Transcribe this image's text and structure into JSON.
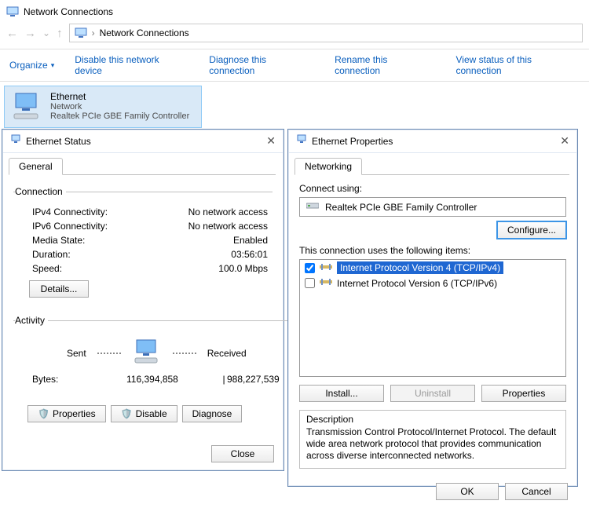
{
  "addressBar": {
    "title": "Network Connections",
    "crumb_sep": "›",
    "crumb": "Network Connections"
  },
  "toolbar": {
    "organize": "Organize",
    "dropdown": "▾",
    "disable": "Disable this network device",
    "diagnose": "Diagnose this connection",
    "rename": "Rename this connection",
    "viewstatus": "View status of this connection"
  },
  "item": {
    "name": "Ethernet",
    "subtype": "Network",
    "adapter": "Realtek PCIe GBE Family Controller"
  },
  "statusDlg": {
    "title": "Ethernet Status",
    "tab": "General",
    "groups": {
      "connection": "Connection",
      "rows": {
        "ipv4_l": "IPv4 Connectivity:",
        "ipv4_v": "No network access",
        "ipv6_l": "IPv6 Connectivity:",
        "ipv6_v": "No network access",
        "media_l": "Media State:",
        "media_v": "Enabled",
        "dur_l": "Duration:",
        "dur_v": "03:56:01",
        "speed_l": "Speed:",
        "speed_v": "100.0 Mbps"
      },
      "details": "Details...",
      "activity": "Activity",
      "sent": "Sent",
      "received": "Received",
      "bytes_l": "Bytes:",
      "bytes_sent": "116,394,858",
      "bytes_recv": "988,227,539",
      "properties": "Properties",
      "disable": "Disable",
      "diagnose": "Diagnose",
      "close": "Close"
    }
  },
  "propsDlg": {
    "title": "Ethernet Properties",
    "tab": "Networking",
    "connectUsingLabel": "Connect using:",
    "adapter": "Realtek PCIe GBE Family Controller",
    "configure": "Configure...",
    "listLabel": "This connection uses the following items:",
    "items": [
      {
        "checked": true,
        "text": "Internet Protocol Version 4 (TCP/IPv4)",
        "selected": true
      },
      {
        "checked": false,
        "text": "Internet Protocol Version 6 (TCP/IPv6)",
        "selected": false
      }
    ],
    "install": "Install...",
    "uninstall": "Uninstall",
    "properties": "Properties",
    "descHead": "Description",
    "descBody": "Transmission Control Protocol/Internet Protocol. The default wide area network protocol that provides communication across diverse interconnected networks.",
    "ok": "OK",
    "cancel": "Cancel"
  }
}
